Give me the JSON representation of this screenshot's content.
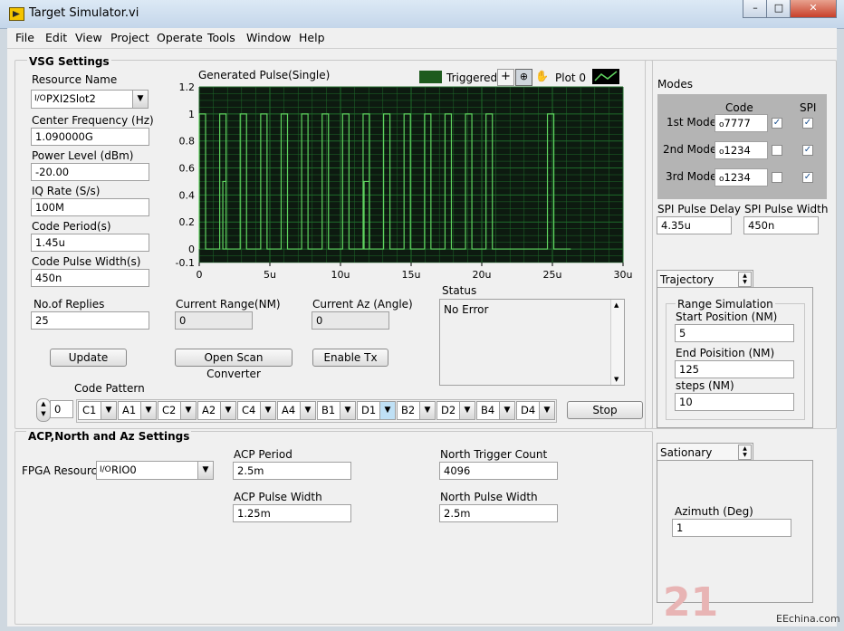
{
  "window": {
    "title": "Target Simulator.vi",
    "controls": {
      "minimize": "–",
      "maximize": "□",
      "close": "✕"
    }
  },
  "menu": [
    "File",
    "Edit",
    "View",
    "Project",
    "Operate",
    "Tools",
    "Window",
    "Help"
  ],
  "vsg": {
    "heading": "VSG Settings",
    "resource_label": "Resource Name",
    "resource_value": "PXI2Slot2",
    "center_freq_label": "Center Frequency (Hz)",
    "center_freq_value": "1.090000G",
    "power_label": "Power Level (dBm)",
    "power_value": "-20.00",
    "iq_label": "IQ Rate (S/s)",
    "iq_value": "100M",
    "code_period_label": "Code Period(s)",
    "code_period_value": "1.45u",
    "code_pulse_label": "Code Pulse Width(s)",
    "code_pulse_value": "450n",
    "replies_label": "No.of Replies",
    "replies_value": "25",
    "update_label": "Update"
  },
  "range": {
    "current_range_label": "Current Range(NM)",
    "current_range_value": "0",
    "current_az_label": "Current Az (Angle)",
    "current_az_value": "0",
    "scan_button": "Open Scan Converter",
    "tx_button": "Enable Tx"
  },
  "status": {
    "label": "Status",
    "value": "No Error"
  },
  "graph": {
    "legend_label": "Triggered?",
    "plot_label": "Plot 0"
  },
  "code_pattern": {
    "label": "Code Pattern",
    "index": "0",
    "items": [
      "C1",
      "A1",
      "C2",
      "A2",
      "C4",
      "A4",
      "B1",
      "D1",
      "B2",
      "D2",
      "B4",
      "D4"
    ],
    "stop_label": "Stop"
  },
  "modes": {
    "title": "Modes",
    "code_header": "Code",
    "spi_header": "SPI",
    "rows": [
      {
        "label": "1st Mode",
        "code": "7777",
        "checked": true,
        "spi": true
      },
      {
        "label": "2nd Mode",
        "code": "1234",
        "checked": false,
        "spi": true
      },
      {
        "label": "3rd Mode",
        "code": "1234",
        "checked": false,
        "spi": true
      }
    ],
    "spi_delay_label": "SPI Pulse Delay",
    "spi_delay_value": "4.35u",
    "spi_width_label": "SPI Pulse Width",
    "spi_width_value": "450n"
  },
  "trajectory": {
    "tab_label": "Trajectory",
    "group_label": "Range Simulation",
    "start_label": "Start Position (NM)",
    "start_value": "5",
    "end_label": "End Poisition (NM)",
    "end_value": "125",
    "steps_label": "steps (NM)",
    "steps_value": "10"
  },
  "acp": {
    "heading": "ACP,North and Az Settings",
    "fpga_label": "FPGA Resource",
    "fpga_value": "RIO0",
    "acp_period_label": "ACP Period",
    "acp_period_value": "2.5m",
    "acp_width_label": "ACP Pulse Width",
    "acp_width_value": "1.25m",
    "north_count_label": "North Trigger Count",
    "north_count_value": "4096",
    "north_width_label": "North Pulse Width",
    "north_width_value": "2.5m"
  },
  "stationary": {
    "tab_label": "Sationary",
    "az_label": "Azimuth (Deg)",
    "az_value": "1"
  },
  "watermark": {
    "text": "21",
    "sub": "EEchina.com"
  },
  "colors": {
    "plot_bg": "#0d1a10",
    "grid": "#1f6b2a",
    "trace": "#5fd35f",
    "legend_swatch": "#1e5b1e"
  },
  "chart_data": {
    "type": "line",
    "title": "Generated Pulse(Single)",
    "xlabel": "",
    "ylabel": "",
    "xlim": [
      0,
      30
    ],
    "ylim": [
      -0.1,
      1.2
    ],
    "x_unit": "u",
    "x_ticks": [
      "0",
      "5u",
      "10u",
      "15u",
      "20u",
      "25u",
      "30u"
    ],
    "y_ticks": [
      "1.2",
      "1",
      "0.8",
      "0.6",
      "0.4",
      "0.2",
      "0",
      "-0.1"
    ],
    "grid": true,
    "series": [
      {
        "name": "Plot 0",
        "pulses": [
          [
            0,
            0.45,
            1
          ],
          [
            1.45,
            1.9,
            1
          ],
          [
            1.67,
            1.9,
            0.5
          ],
          [
            2.9,
            3.35,
            1
          ],
          [
            4.35,
            4.8,
            1
          ],
          [
            5.8,
            6.25,
            1
          ],
          [
            7.25,
            7.7,
            1
          ],
          [
            8.7,
            9.15,
            1
          ],
          [
            10.15,
            10.6,
            1
          ],
          [
            11.6,
            12.05,
            1
          ],
          [
            11.67,
            12.05,
            0.5
          ],
          [
            13.05,
            13.5,
            1
          ],
          [
            14.5,
            14.95,
            1
          ],
          [
            15.95,
            16.4,
            1
          ],
          [
            17.4,
            17.85,
            1
          ],
          [
            18.85,
            19.3,
            1
          ],
          [
            20.3,
            20.75,
            1
          ],
          [
            24.65,
            25.1,
            1
          ]
        ],
        "end": 26.3
      }
    ]
  }
}
